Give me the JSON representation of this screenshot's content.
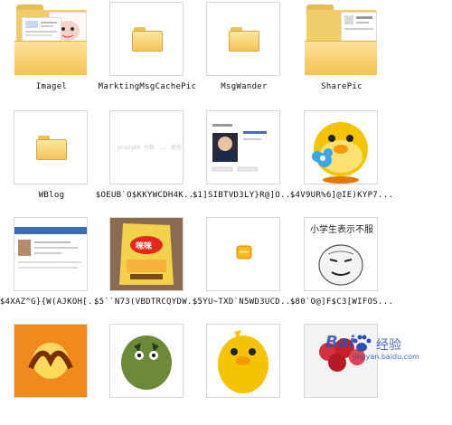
{
  "files": [
    {
      "label": "Imagel",
      "icon": "folder-with-images-icon"
    },
    {
      "label": "MarktingMsgCachePic",
      "icon": "folder-icon"
    },
    {
      "label": "MsgWander",
      "icon": "folder-icon"
    },
    {
      "label": "SharePic",
      "icon": "folder-with-images-icon"
    },
    {
      "label": "WBlog",
      "icon": "folder-icon"
    },
    {
      "label": "$OEUB`O$KKYWCDH4K...",
      "icon": "image-thumbnail"
    },
    {
      "label": "$1]SIBTVD3LY}R@]O...",
      "icon": "image-thumbnail"
    },
    {
      "label": "$4V9UR%6]@IE)KYP7...",
      "icon": "image-thumbnail"
    },
    {
      "label": "$4XAZ^G}{W(AJKOH[...",
      "icon": "image-thumbnail"
    },
    {
      "label": "$5``N73(VBDTRCQYDW...",
      "icon": "image-thumbnail"
    },
    {
      "label": "$5YU~TXD`N5WD3UCD...",
      "icon": "image-thumbnail"
    },
    {
      "label": "$80`O@]F$C3[WIFOS...",
      "icon": "image-thumbnail"
    },
    {
      "label": "",
      "icon": "image-thumbnail"
    },
    {
      "label": "",
      "icon": "image-thumbnail"
    },
    {
      "label": "",
      "icon": "image-thumbnail"
    },
    {
      "label": "",
      "icon": "image-thumbnail"
    }
  ],
  "thumb_text": {
    "cartoon_title": "小学生表示不服",
    "snack_label": "咪咪",
    "blur_text": "wrong89 分数 ... 类型: 370"
  },
  "watermark": {
    "brand": "Bai",
    "brand2": "经验",
    "url": "jingyan.baidu.com"
  },
  "colors": {
    "folder": "#f2c557",
    "folder_light": "#ffe7a2",
    "accent_yellow": "#f5c400",
    "watermark_blue": "#2d4fb5"
  }
}
